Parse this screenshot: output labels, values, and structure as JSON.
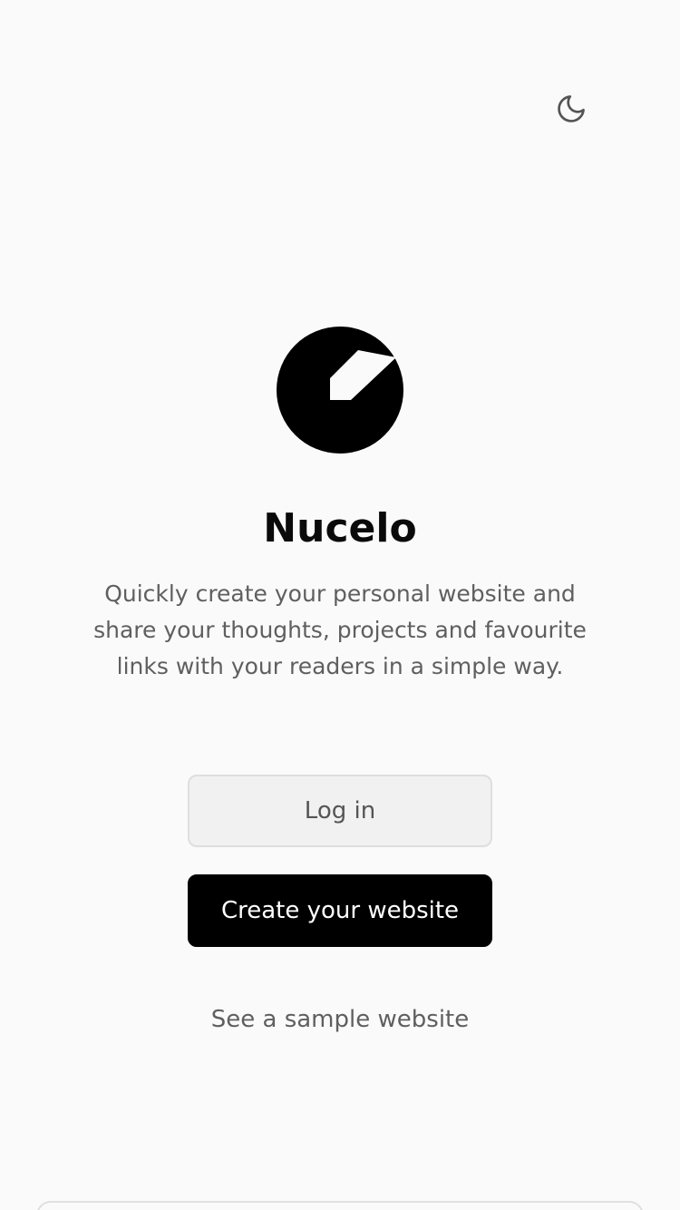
{
  "header": {
    "theme_toggle_icon": "moon-icon"
  },
  "brand": {
    "logo_icon": "nucelo-logo-icon",
    "name": "Nucelo",
    "tagline": "Quickly create your personal website and share your thoughts, projects and favourite links with your readers in a simple way."
  },
  "actions": {
    "login_label": "Log in",
    "create_label": "Create your website",
    "sample_label": "See a sample website"
  },
  "colors": {
    "background": "#fafafa",
    "primary": "#000000",
    "secondary_bg": "#f1f1f1",
    "muted_text": "#5f5f5f"
  }
}
